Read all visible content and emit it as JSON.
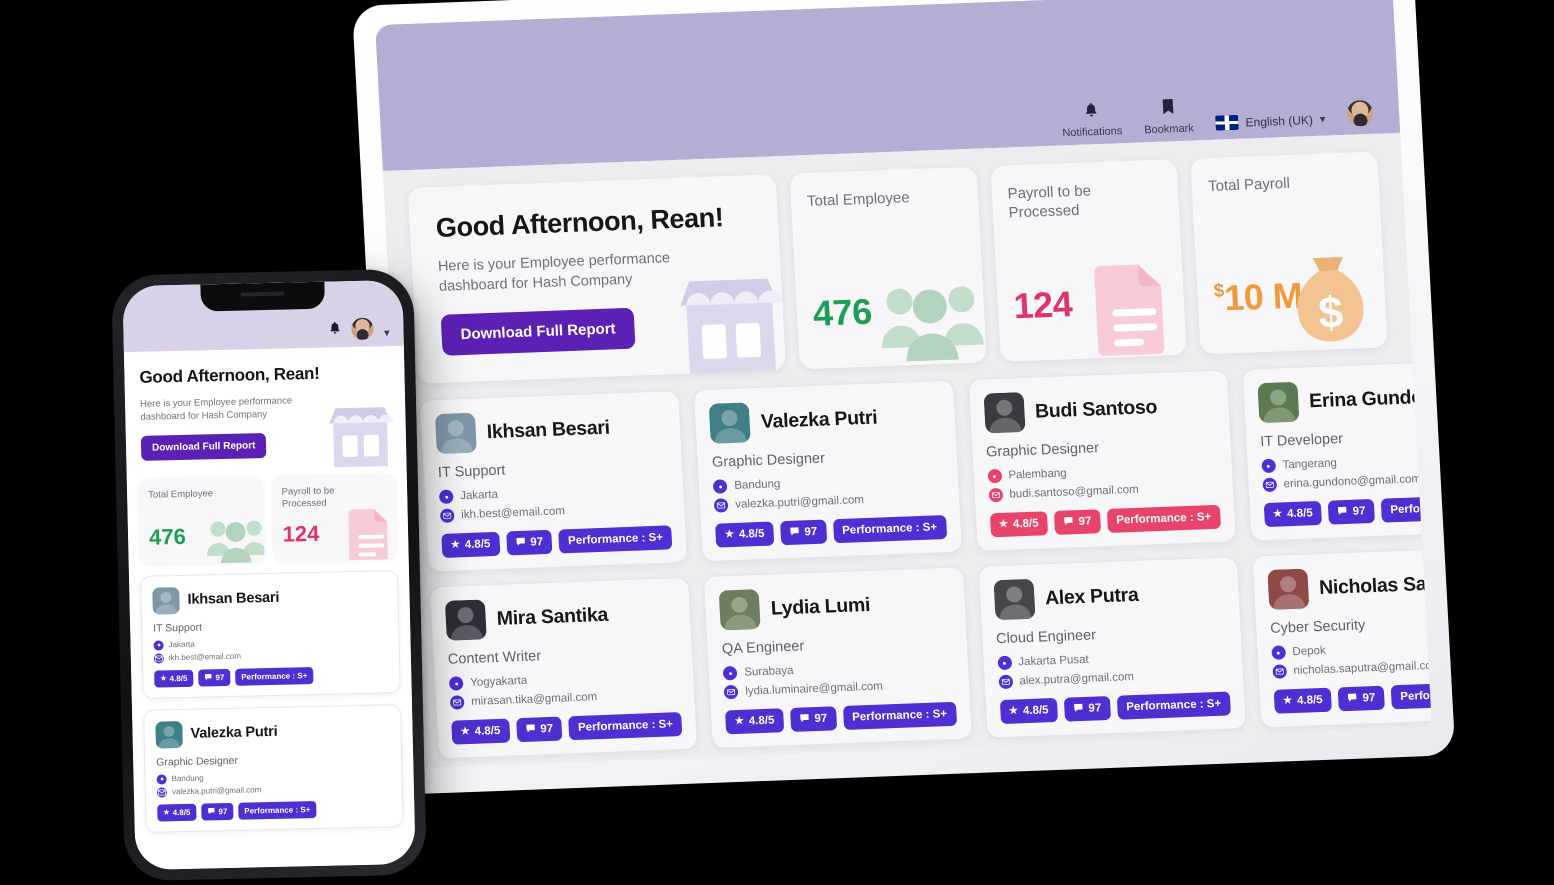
{
  "colors": {
    "accent_purple": "#5b21b5",
    "badge_purple": "#4f2fd1",
    "badge_pink": "#e8436b",
    "topbar_lavender": "#b5aed4",
    "phone_topbar_lavender": "#d8d1e8",
    "stat_green": "#1e9e53",
    "stat_pink": "#e0336b",
    "stat_orange": "#ef9a3c",
    "page_bg": "#edecef",
    "canvas_bg": "#000000"
  },
  "desktop": {
    "topbar": {
      "notifications": {
        "label": "Notifications",
        "icon": "bell-icon"
      },
      "bookmark": {
        "label": "Bookmark",
        "icon": "bookmark-icon"
      },
      "language": {
        "label": "English (UK)",
        "flag": "uk-flag-icon",
        "chevron": "chevron-down-icon"
      },
      "avatar": "user-avatar"
    },
    "greeting": {
      "title": "Good Afternoon, Rean!",
      "subtitle": "Here is your Employee performance dashboard for Hash Company",
      "button_label": "Download Full Report",
      "art": "storefront-illustration"
    },
    "stats": [
      {
        "label": "Total Employee",
        "value": "476",
        "currency": "",
        "color": "#1e9e53",
        "art": "people-icon"
      },
      {
        "label": "Payroll to be Processed",
        "value": "124",
        "currency": "",
        "color": "#e0336b",
        "art": "document-icon"
      },
      {
        "label": "Total Payroll",
        "value": "10 M",
        "currency": "$",
        "color": "#ef9a3c",
        "art": "money-bag-icon"
      }
    ],
    "employees": [
      {
        "name": "Ikhsan Besari",
        "role": "IT Support",
        "location": "Jakarta",
        "email": "ikh.best@email.com",
        "rating": "4.8/5",
        "comments": "97",
        "performance": "Performance : S+",
        "theme": "purple",
        "photo_tone": "#7f98a8"
      },
      {
        "name": "Valezka Putri",
        "role": "Graphic Designer",
        "location": "Bandung",
        "email": "valezka.putri@gmail.com",
        "rating": "4.8/5",
        "comments": "97",
        "performance": "Performance : S+",
        "theme": "purple",
        "photo_tone": "#3f7f86"
      },
      {
        "name": "Budi Santoso",
        "role": "Graphic Designer",
        "location": "Palembang",
        "email": "budi.santoso@gmail.com",
        "rating": "4.8/5",
        "comments": "97",
        "performance": "Performance : S+",
        "theme": "pink",
        "photo_tone": "#3a3a42"
      },
      {
        "name": "Erina Gundono",
        "role": "IT Developer",
        "location": "Tangerang",
        "email": "erina.gundono@gmail.com",
        "rating": "4.8/5",
        "comments": "97",
        "performance": "Performance : S+",
        "theme": "purple",
        "photo_tone": "#5b7a4f"
      },
      {
        "name": "Mira Santika",
        "role": "Content Writer",
        "location": "Yogyakarta",
        "email": "mirasan.tika@gmail.com",
        "rating": "4.8/5",
        "comments": "97",
        "performance": "Performance : S+",
        "theme": "purple",
        "photo_tone": "#2e2d38"
      },
      {
        "name": "Lydia Lumi",
        "role": "QA Engineer",
        "location": "Surabaya",
        "email": "lydia.luminaire@gmail.com",
        "rating": "4.8/5",
        "comments": "97",
        "performance": "Performance : S+",
        "theme": "purple",
        "photo_tone": "#6a7f5e"
      },
      {
        "name": "Alex Putra",
        "role": "Cloud Engineer",
        "location": "Jakarta Pusat",
        "email": "alex.putra@gmail.com",
        "rating": "4.8/5",
        "comments": "97",
        "performance": "Performance : S+",
        "theme": "purple",
        "photo_tone": "#45454e"
      },
      {
        "name": "Nicholas Saputra",
        "role": "Cyber Security",
        "location": "Depok",
        "email": "nicholas.saputra@gmail.com",
        "rating": "4.8/5",
        "comments": "97",
        "performance": "Performance : S+",
        "theme": "purple",
        "photo_tone": "#8e4a46"
      }
    ]
  },
  "phone": {
    "topbar": {
      "notifications_icon": "bell-icon",
      "avatar": "user-avatar",
      "chevron": "chevron-down-icon"
    },
    "greeting": {
      "title": "Good Afternoon, Rean!",
      "subtitle": "Here is your Employee performance dashboard for Hash Company",
      "button_label": "Download Full Report",
      "art": "storefront-illustration"
    },
    "stats": [
      {
        "label": "Total Employee",
        "value": "476",
        "color": "#1e9e53",
        "art": "people-icon"
      },
      {
        "label": "Payroll to be Processed",
        "value": "124",
        "color": "#e0336b",
        "art": "document-icon"
      }
    ],
    "employees": [
      {
        "name": "Ikhsan Besari",
        "role": "IT Support",
        "location": "Jakarta",
        "email": "ikh.best@email.com",
        "rating": "4.8/5",
        "comments": "97",
        "performance": "Performance : S+",
        "theme": "purple",
        "photo_tone": "#7f98a8"
      },
      {
        "name": "Valezka Putri",
        "role": "Graphic Designer",
        "location": "Bandung",
        "email": "valezka.putri@gmail.com",
        "rating": "4.8/5",
        "comments": "97",
        "performance": "Performance : S+",
        "theme": "purple",
        "photo_tone": "#3f7f86"
      }
    ]
  },
  "icons": {
    "location": "📍",
    "email": "✉",
    "star": "★",
    "comment": "💬",
    "bell": "🔔",
    "bookmark": "🔖"
  }
}
